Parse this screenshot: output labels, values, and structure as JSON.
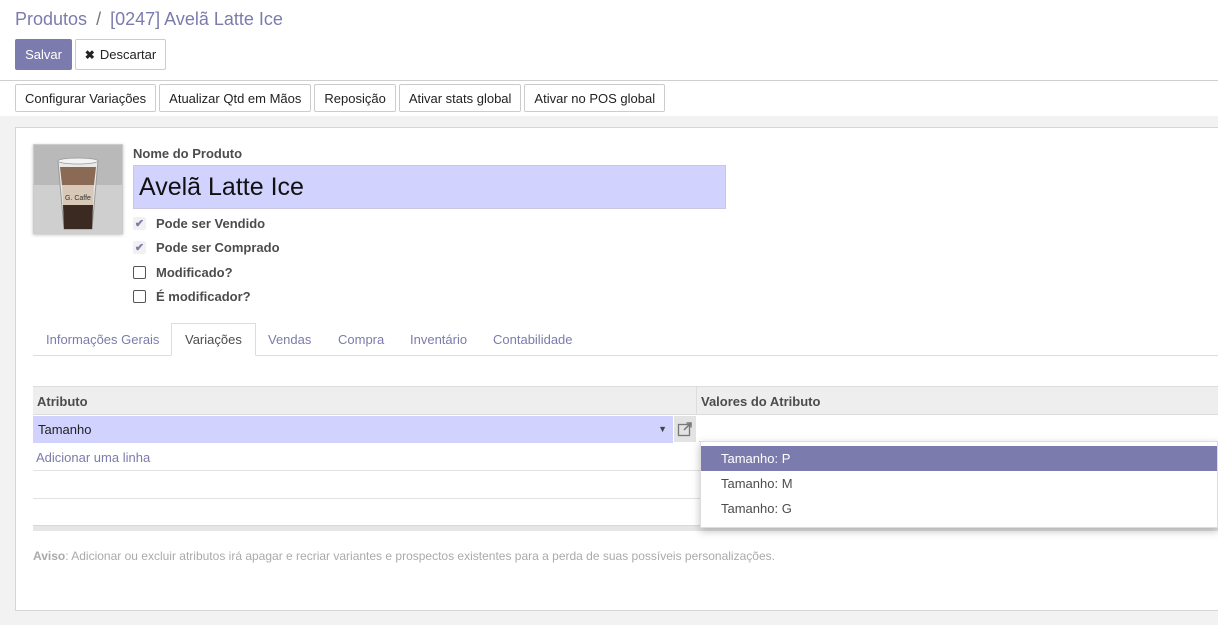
{
  "breadcrumb": {
    "parent": "Produtos",
    "separator": "/",
    "current": "[0247] Avelã Latte Ice"
  },
  "actions": {
    "save_label": "Salvar",
    "discard_label": "Descartar"
  },
  "statusbar": {
    "buttons": [
      "Configurar Variações",
      "Atualizar Qtd em Mãos",
      "Reposição",
      "Ativar stats global",
      "Ativar no POS global"
    ]
  },
  "product": {
    "image_caption": "G. Caffe",
    "name_label": "Nome do Produto",
    "name_value": "Avelã Latte Ice",
    "checkboxes": [
      {
        "label": "Pode ser Vendido",
        "checked": true
      },
      {
        "label": "Pode ser Comprado",
        "checked": true
      },
      {
        "label": "Modificado?",
        "checked": false
      },
      {
        "label": "É modificador?",
        "checked": false
      }
    ]
  },
  "tabs": [
    "Informações Gerais",
    "Variações",
    "Vendas",
    "Compra",
    "Inventário",
    "Contabilidade"
  ],
  "active_tab": "Variações",
  "table": {
    "col_attribute": "Atributo",
    "col_values": "Valores do Atributo",
    "attribute_value": "Tamanho",
    "add_line": "Adicionar uma linha"
  },
  "dropdown": {
    "options": [
      "Tamanho: P",
      "Tamanho: M",
      "Tamanho: G"
    ],
    "highlighted": "Tamanho: P"
  },
  "warning": {
    "title": "Aviso",
    "text": ": Adicionar ou excluir atributos irá apagar e recriar variantes e prospectos existentes para a perda de suas possíveis personalizações."
  },
  "colors": {
    "primary": "#7c7bad",
    "input_bg": "#d2d2ff"
  }
}
